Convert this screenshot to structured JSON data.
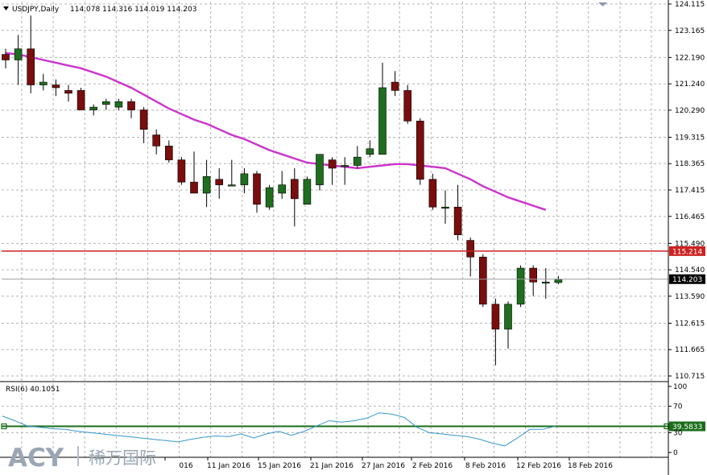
{
  "header": {
    "title": "USDJPY,Daily",
    "ohlc": "114.078 114.316 114.019 114.203"
  },
  "rsi": {
    "label": "RSI(6) 40.1051",
    "current_value": "39.5833"
  },
  "watermark": {
    "brand": "ACY",
    "chinese": "稀万国际"
  },
  "colors": {
    "bull": "#1e6e1e",
    "bear": "#7a0d0d",
    "ma": "#cc33cc",
    "hline": "#cc2222",
    "rsi_line": "#3399cc",
    "rsi_level": "#1a6e1a",
    "grid": "#b4b4b4"
  },
  "chart_data": [
    {
      "type": "candlestick",
      "title": "USDJPY,Daily",
      "y_ticks": [
        "124.115",
        "123.165",
        "122.190",
        "121.240",
        "120.290",
        "119.315",
        "118.365",
        "117.415",
        "116.465",
        "115.490",
        "114.540",
        "113.590",
        "112.615",
        "111.665",
        "110.715"
      ],
      "x_tick_labels": [
        "4 Jan 2016",
        "11 Jan 2016",
        "15 Jan 2016",
        "21 Jan 2016",
        "27 Jan 2016",
        "2 Feb 2016",
        "8 Feb 2016",
        "12 Feb 2016",
        "18 Feb 2016"
      ],
      "x_tick_visible": [
        "016",
        "11 Jan 2016",
        "15 Jan 2016",
        "21 Jan 2016",
        "27 Jan 2016",
        "2 Feb 2016",
        "8 Feb 2016",
        "12 Feb 2016",
        "18 Feb 2016"
      ],
      "ylim": [
        110.45,
        124.3
      ],
      "grid": true,
      "current_price": {
        "value": 114.203,
        "label": "114.203"
      },
      "horizontal_line": {
        "value": 115.214,
        "label": "115.214"
      },
      "candles": [
        [
          122.3,
          122.5,
          121.8,
          122.1
        ],
        [
          122.1,
          123.0,
          121.2,
          122.5
        ],
        [
          122.5,
          123.7,
          120.9,
          121.2
        ],
        [
          121.2,
          121.6,
          121.0,
          121.3
        ],
        [
          121.2,
          121.4,
          120.8,
          121.1
        ],
        [
          121.0,
          121.2,
          120.6,
          120.9
        ],
        [
          121.0,
          121.1,
          120.3,
          120.3
        ],
        [
          120.3,
          120.5,
          120.1,
          120.4
        ],
        [
          120.5,
          120.7,
          120.3,
          120.6
        ],
        [
          120.4,
          120.7,
          120.3,
          120.6
        ],
        [
          120.6,
          120.7,
          120.0,
          120.3
        ],
        [
          120.3,
          120.4,
          119.1,
          119.6
        ],
        [
          119.4,
          119.6,
          118.7,
          119.0
        ],
        [
          119.0,
          119.2,
          118.4,
          118.5
        ],
        [
          118.5,
          118.6,
          117.6,
          117.7
        ],
        [
          117.7,
          118.8,
          117.3,
          117.3
        ],
        [
          117.3,
          118.5,
          116.8,
          117.9
        ],
        [
          117.8,
          118.2,
          117.1,
          117.6
        ],
        [
          117.6,
          118.5,
          117.6,
          117.6
        ],
        [
          117.6,
          118.2,
          117.3,
          118.0
        ],
        [
          118.0,
          118.1,
          116.6,
          116.9
        ],
        [
          116.8,
          117.6,
          116.7,
          117.5
        ],
        [
          117.3,
          118.1,
          117.1,
          117.6
        ],
        [
          117.8,
          118.2,
          116.1,
          117.1
        ],
        [
          116.9,
          117.9,
          116.9,
          117.8
        ],
        [
          117.6,
          118.7,
          117.4,
          118.7
        ],
        [
          118.5,
          118.6,
          117.6,
          118.2
        ],
        [
          118.3,
          118.6,
          117.6,
          118.3
        ],
        [
          118.3,
          119.0,
          118.2,
          118.6
        ],
        [
          118.7,
          119.2,
          118.6,
          118.9
        ],
        [
          118.7,
          122.0,
          118.7,
          121.1
        ],
        [
          121.3,
          121.7,
          120.8,
          121.0
        ],
        [
          121.0,
          121.2,
          119.8,
          119.9
        ],
        [
          119.9,
          120.0,
          117.6,
          117.8
        ],
        [
          117.8,
          118.0,
          116.7,
          116.8
        ],
        [
          116.8,
          117.4,
          116.2,
          116.8
        ],
        [
          116.8,
          117.6,
          115.6,
          115.8
        ],
        [
          115.6,
          115.7,
          114.3,
          115.0
        ],
        [
          115.0,
          115.1,
          113.2,
          113.3
        ],
        [
          113.3,
          113.5,
          111.1,
          112.4
        ],
        [
          112.4,
          113.4,
          111.7,
          113.3
        ],
        [
          113.3,
          114.7,
          113.2,
          114.6
        ],
        [
          114.6,
          114.7,
          113.6,
          114.1
        ],
        [
          114.1,
          114.6,
          113.5,
          114.1
        ],
        [
          114.08,
          114.32,
          114.02,
          114.2
        ]
      ],
      "moving_average": [
        122.35,
        122.3,
        122.2,
        122.1,
        122.0,
        121.9,
        121.8,
        121.65,
        121.5,
        121.3,
        121.1,
        120.85,
        120.6,
        120.35,
        120.15,
        119.95,
        119.8,
        119.6,
        119.4,
        119.25,
        119.05,
        118.85,
        118.7,
        118.55,
        118.4,
        118.35,
        118.3,
        118.25,
        118.2,
        118.25,
        118.3,
        118.35,
        118.35,
        118.3,
        118.25,
        118.2,
        118.0,
        117.8,
        117.55,
        117.35,
        117.15,
        117.0,
        116.85,
        116.7
      ],
      "rsi": {
        "title": "RSI(6) 40.1051",
        "y_ticks": [
          "100",
          "70",
          "30",
          "0"
        ],
        "ylim": [
          0,
          100
        ],
        "levels": [
          39.5833
        ],
        "values": [
          55,
          48,
          40,
          38,
          36,
          35,
          32,
          30,
          28,
          26,
          24,
          22,
          20,
          18,
          16,
          20,
          23,
          25,
          24,
          28,
          22,
          28,
          32,
          26,
          32,
          40,
          48,
          46,
          48,
          52,
          60,
          58,
          53,
          38,
          30,
          28,
          26,
          24,
          20,
          14,
          10,
          22,
          35,
          35,
          39.6
        ]
      }
    }
  ]
}
